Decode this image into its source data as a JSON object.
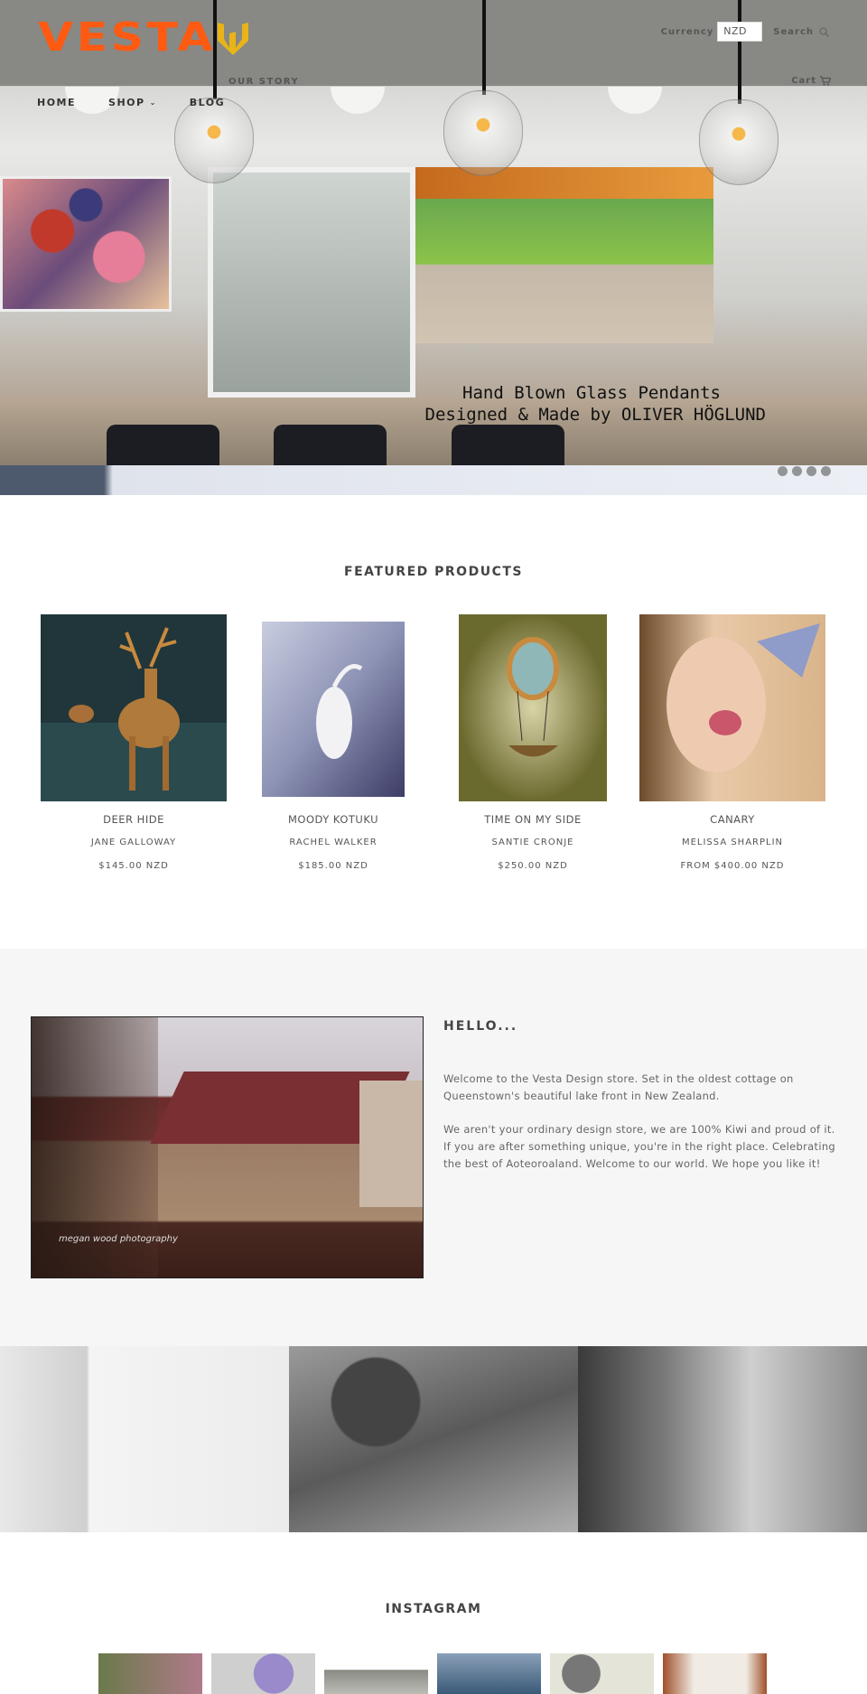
{
  "header": {
    "brand": "VESTA",
    "currency_label": "Currency",
    "currency_value": "NZD",
    "search_label": "Search",
    "cart_label": "Cart",
    "nav": [
      {
        "label": "HOME",
        "has_dropdown": false
      },
      {
        "label": "SHOP",
        "has_dropdown": true
      },
      {
        "label": "BLOG",
        "has_dropdown": false
      },
      {
        "label": "OUR STORY",
        "has_dropdown": false
      }
    ]
  },
  "hero": {
    "caption_line1": "Hand Blown Glass Pendants",
    "caption_line2": "Designed & Made by OLIVER HÖGLUND",
    "slide_count": 4
  },
  "featured": {
    "title": "FEATURED PRODUCTS",
    "products": [
      {
        "name": "DEER HIDE",
        "artist": "JANE GALLOWAY",
        "price": "$145.00 NZD"
      },
      {
        "name": "MOODY KOTUKU",
        "artist": "RACHEL WALKER",
        "price": "$185.00 NZD"
      },
      {
        "name": "TIME ON MY SIDE",
        "artist": "SANTIE CRONJE",
        "price": "$250.00 NZD"
      },
      {
        "name": "CANARY",
        "artist": "MELISSA SHARPLIN",
        "price": "FROM $400.00 NZD"
      }
    ]
  },
  "hello": {
    "title": "HELLO...",
    "paragraph1": "Welcome to the Vesta Design store. Set in the oldest cottage on Queenstown's beautiful lake front in New Zealand.",
    "paragraph2": "We aren't your ordinary design store, we are 100% Kiwi and proud of it. If you are after something unique, you're in the right place. Celebrating the best of Aoteoroaland. Welcome to our world. We hope you like it!",
    "image_watermark": "megan wood photography"
  },
  "instagram": {
    "title": "INSTAGRAM",
    "tile_count": 6
  },
  "colors": {
    "brand_orange": "#ff5a12",
    "brand_yellow": "#e8b418",
    "band_gray": "#f6f6f6",
    "heading": "#444444"
  }
}
